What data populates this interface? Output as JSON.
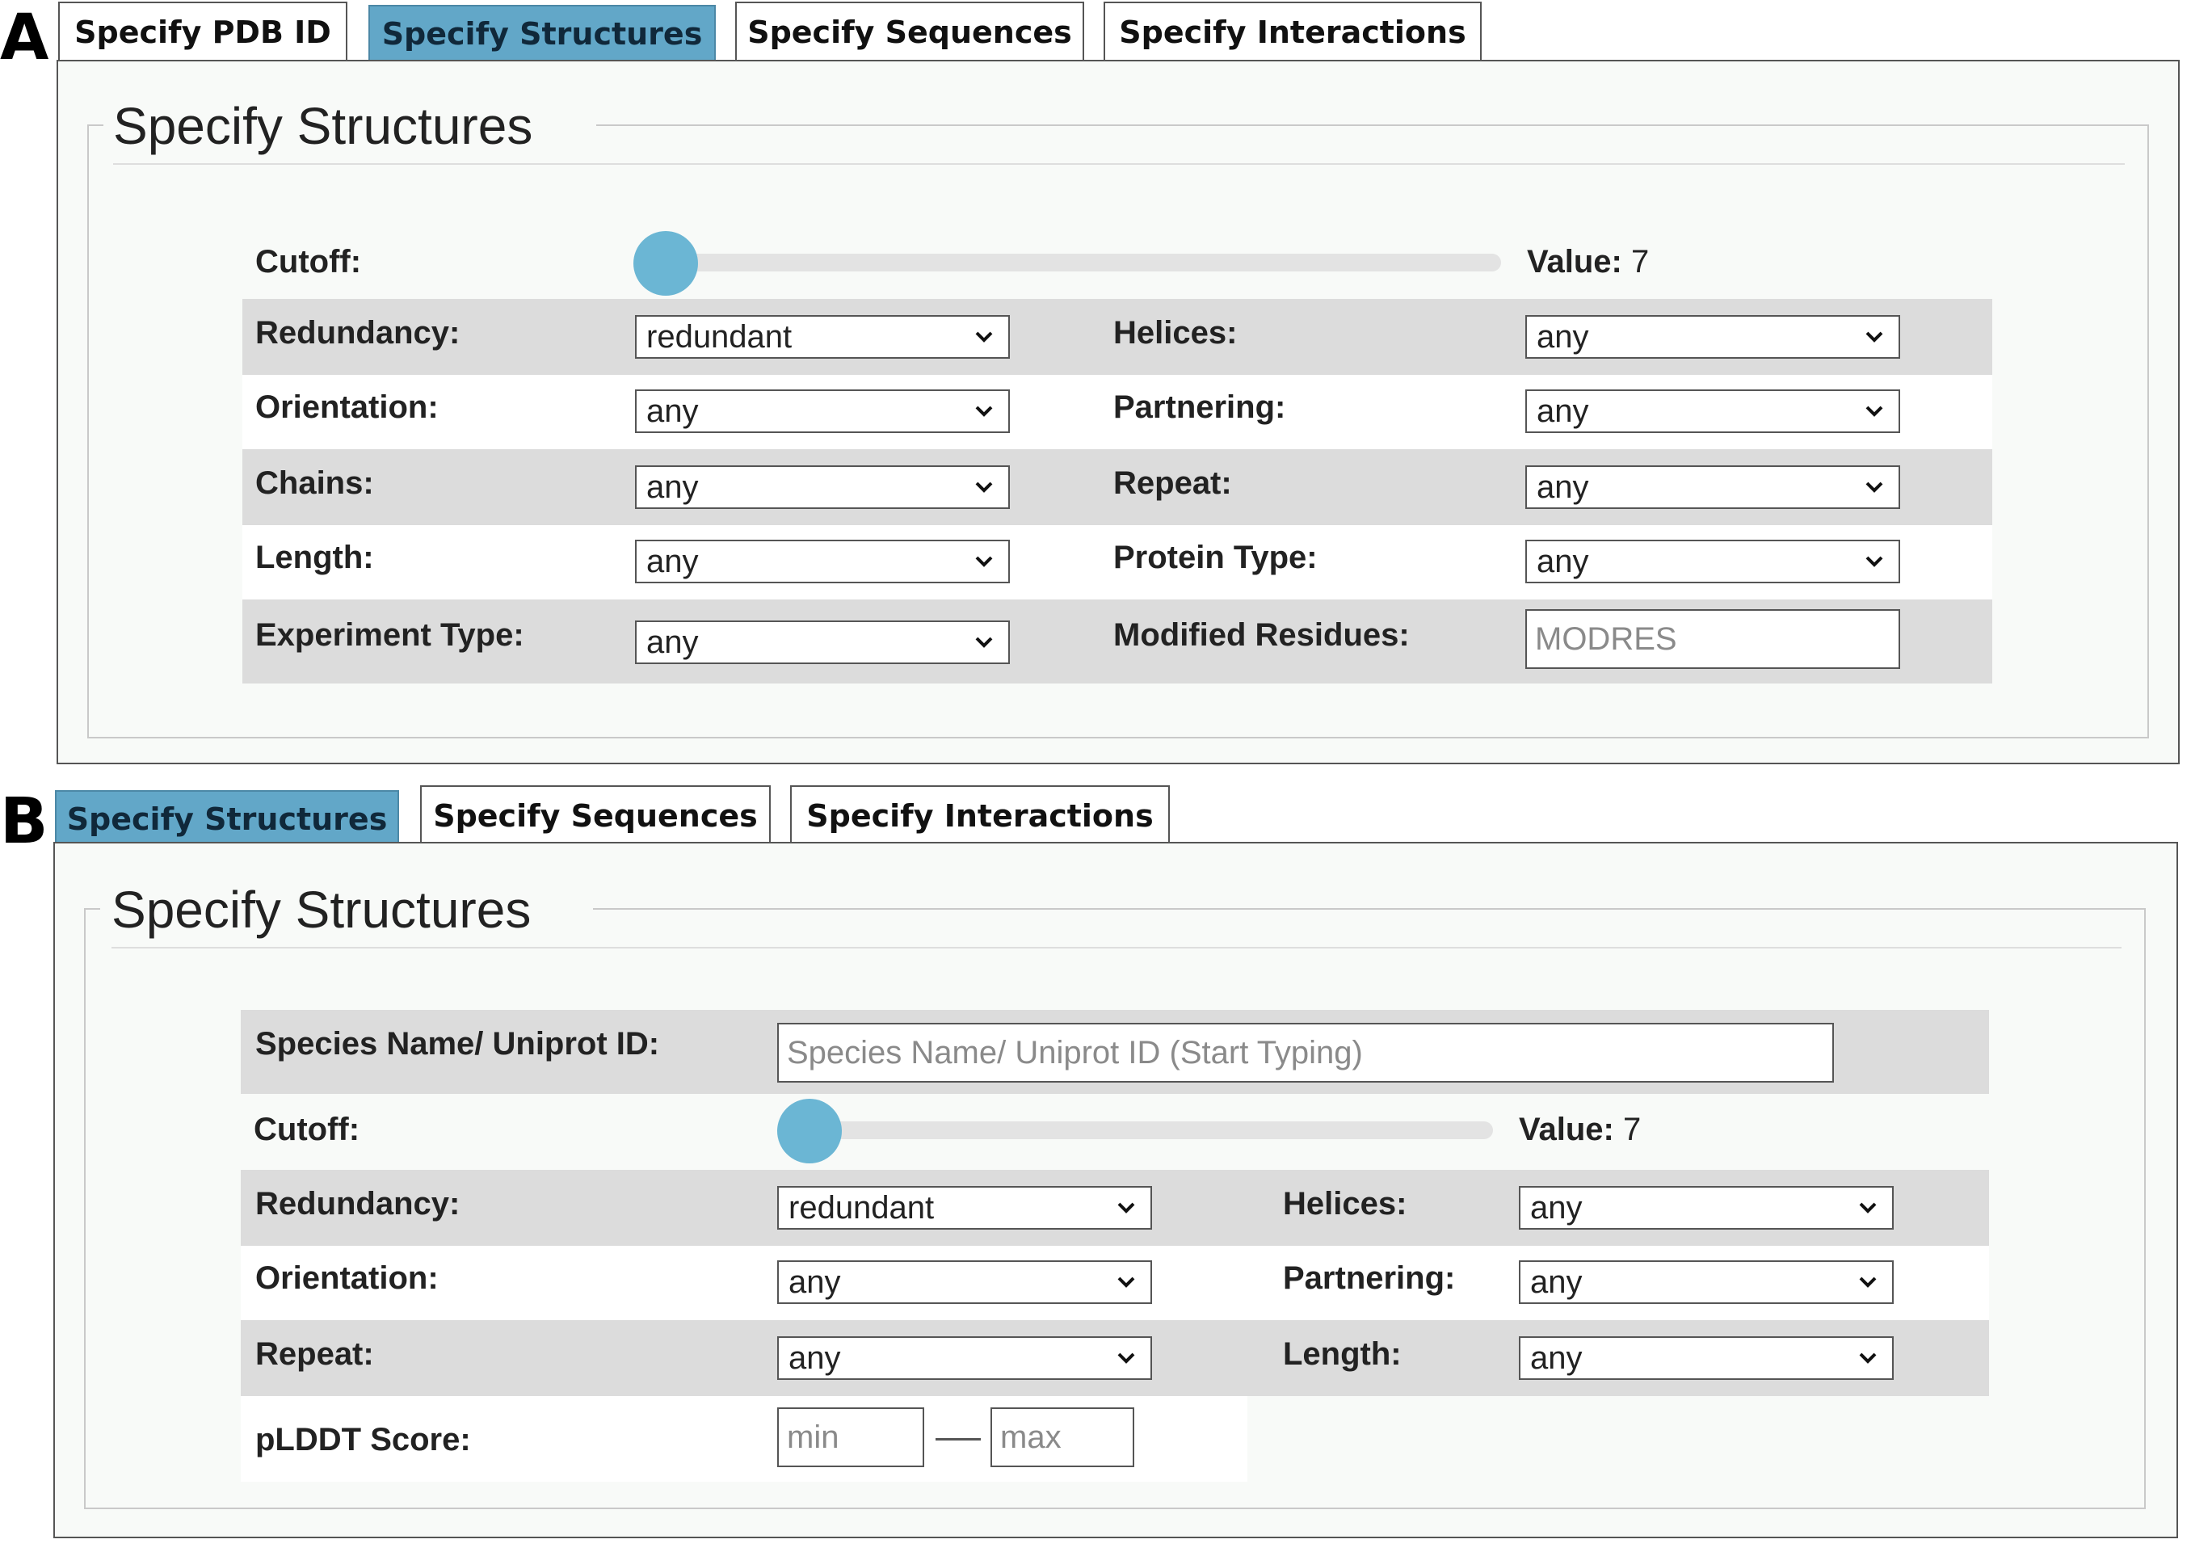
{
  "panel_a": {
    "letter": "A",
    "tabs": [
      {
        "label": "Specify PDB ID",
        "active": false
      },
      {
        "label": "Specify Structures",
        "active": true
      },
      {
        "label": "Specify Sequences",
        "active": false
      },
      {
        "label": "Specify Interactions",
        "active": false
      }
    ],
    "legend": "Specify Structures",
    "cutoff": {
      "label": "Cutoff:",
      "value_label": "Value:",
      "value": "7",
      "level": 0
    },
    "rows": [
      {
        "left_label": "Redundancy:",
        "left_value": "redundant",
        "right_label": "Helices:",
        "right_value": "any"
      },
      {
        "left_label": "Orientation:",
        "left_value": "any",
        "right_label": "Partnering:",
        "right_value": "any"
      },
      {
        "left_label": "Chains:",
        "left_value": "any",
        "right_label": "Repeat:",
        "right_value": "any"
      },
      {
        "left_label": "Length:",
        "left_value": "any",
        "right_label": "Protein Type:",
        "right_value": "any"
      },
      {
        "left_label": "Experiment Type:",
        "left_value": "any",
        "right_label": "Modified Residues:",
        "right_placeholder": "MODRES"
      }
    ]
  },
  "panel_b": {
    "letter": "B",
    "tabs": [
      {
        "label": "Specify Structures",
        "active": true
      },
      {
        "label": "Specify Sequences",
        "active": false
      },
      {
        "label": "Specify Interactions",
        "active": false
      }
    ],
    "legend": "Specify Structures",
    "species": {
      "label": "Species Name/ Uniprot ID:",
      "placeholder": "Species Name/ Uniprot ID (Start Typing)"
    },
    "cutoff": {
      "label": "Cutoff:",
      "value_label": "Value:",
      "value": "7",
      "level": 0
    },
    "rows": [
      {
        "left_label": "Redundancy:",
        "left_value": "redundant",
        "right_label": "Helices:",
        "right_value": "any"
      },
      {
        "left_label": "Orientation:",
        "left_value": "any",
        "right_label": "Partnering:",
        "right_value": "any"
      },
      {
        "left_label": "Repeat:",
        "left_value": "any",
        "right_label": "Length:",
        "right_value": "any"
      }
    ],
    "plddt": {
      "label": "pLDDT Score:",
      "min_placeholder": "min",
      "max_placeholder": "max"
    }
  },
  "colors": {
    "active_tab": "#62a7c8",
    "slider_thumb": "#6bb6d4",
    "row_shade": "#dcdcdc"
  },
  "icons": {
    "select_arrow": "chevron-down-icon"
  }
}
